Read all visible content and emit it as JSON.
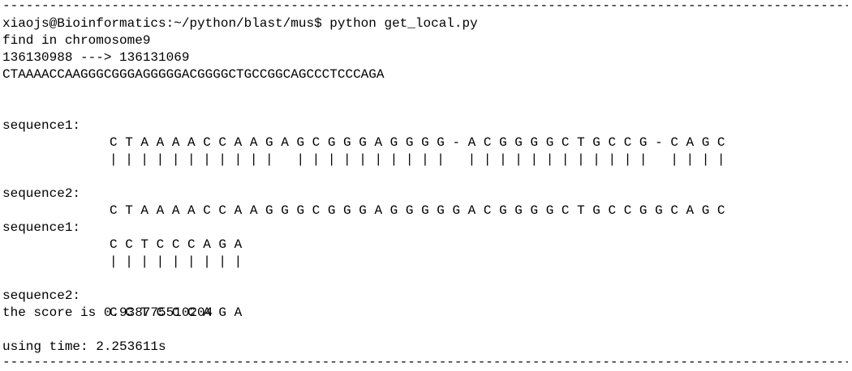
{
  "terminal": {
    "top_rule": "---------------------------------------------------------------------------------------------------------------------------------------------",
    "prompt": "xiaojs@Bioinformatics:~/python/blast/mus$ python get_local.py",
    "find_line": "find in chromosome9",
    "range_line": "136130988 ---> 136131069",
    "full_sequence": "CTAAAACCAAGGGCGGGAGGGGGACGGGGCTGCCGGCAGCCCTCCCAGA",
    "block1": {
      "seq1_label": "sequence1:",
      "seq1": "C T A A A A C C A A G A G C G G G A G G G G - A C G G G G C T G C C G - C A G C",
      "match": "| | | | | | | | | | |   | | | | | | | | | |   | | | | | | | | | | | |   | | | |",
      "seq2_label": "sequence2:",
      "seq2": "C T A A A A C C A A G G G C G G G A G G G G G A C G G G G C T G C C G G C A G C"
    },
    "block2": {
      "seq1_label": "sequence1:",
      "seq1": "C C T C C C A G A",
      "match": "| | | | | | | | |",
      "seq2_label": "sequence2:",
      "seq2": "C C T C C C A G A"
    },
    "score_line": "the score is 0.938775510204",
    "time_line": "using time: 2.253611s",
    "bottom_rule": "---------------------------------------------------------------------------------------------------------------------------------------------"
  }
}
